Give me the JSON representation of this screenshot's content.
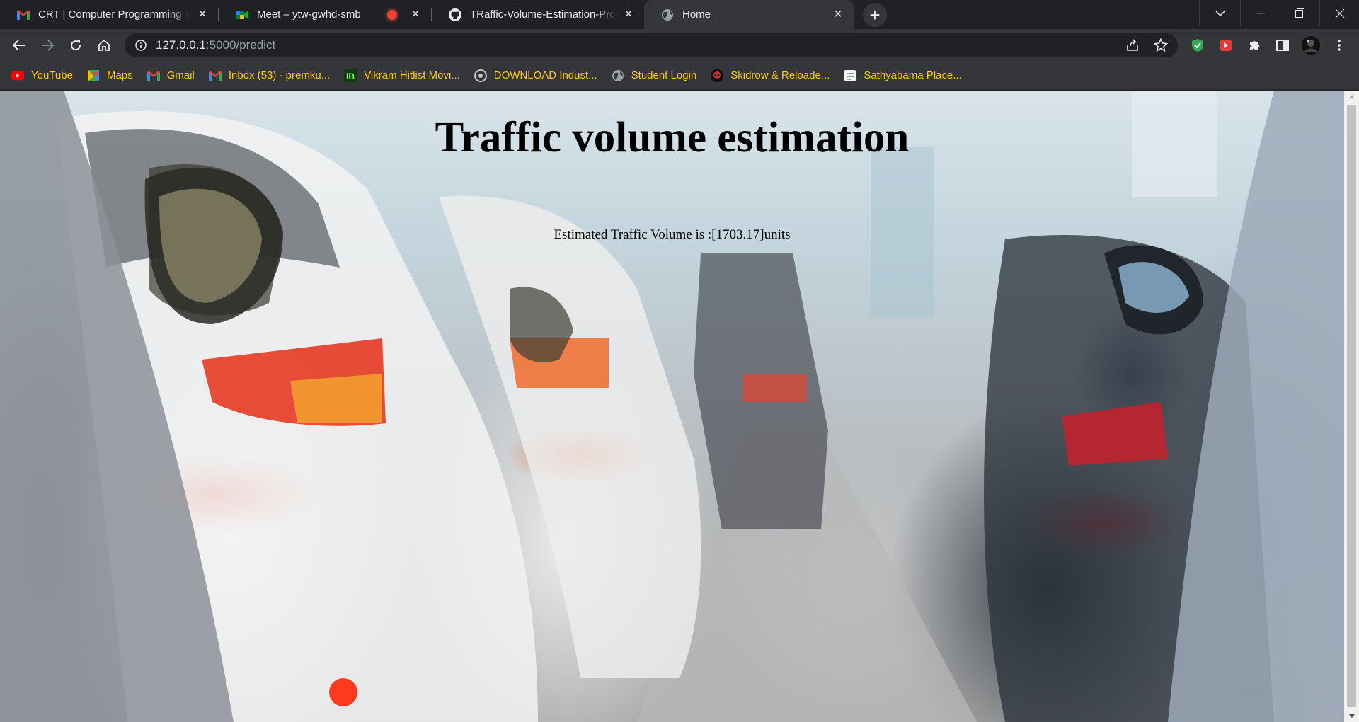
{
  "browser": {
    "tabs": [
      {
        "title": "CRT | Computer Programming Tr",
        "favicon": "gmail-icon",
        "active": false
      },
      {
        "title": "Meet – ytw-gwhd-smb",
        "favicon": "meet-icon",
        "active": false,
        "recording": true
      },
      {
        "title": "TRaffic-Volume-Estimation-Proje",
        "favicon": "github-icon",
        "active": false
      },
      {
        "title": "Home",
        "favicon": "globe-icon",
        "active": true
      }
    ],
    "new_tab_symbol": "+",
    "address": {
      "host": "127.0.0.1",
      "path": ":5000/predict"
    },
    "bookmarks": [
      {
        "label": "YouTube",
        "icon": "youtube-icon"
      },
      {
        "label": "Maps",
        "icon": "maps-icon"
      },
      {
        "label": "Gmail",
        "icon": "gmail-icon"
      },
      {
        "label": "Inbox (53) - premku...",
        "icon": "gmail-icon"
      },
      {
        "label": "Vikram Hitlist Movi...",
        "icon": "ib-icon"
      },
      {
        "label": "DOWNLOAD Indust...",
        "icon": "settings-globe-icon"
      },
      {
        "label": "Student Login",
        "icon": "globe-icon"
      },
      {
        "label": "Skidrow & Reloade...",
        "icon": "skull-icon"
      },
      {
        "label": "Sathyabama Place...",
        "icon": "page-icon"
      }
    ]
  },
  "page": {
    "heading": "Traffic volume estimation",
    "result_text": "Estimated Traffic Volume is :[1703.17]units"
  },
  "colors": {
    "tabstrip": "#202124",
    "toolbar": "#35363a",
    "bookmark_text": "#ffcc00",
    "heading_text": "#000000"
  }
}
